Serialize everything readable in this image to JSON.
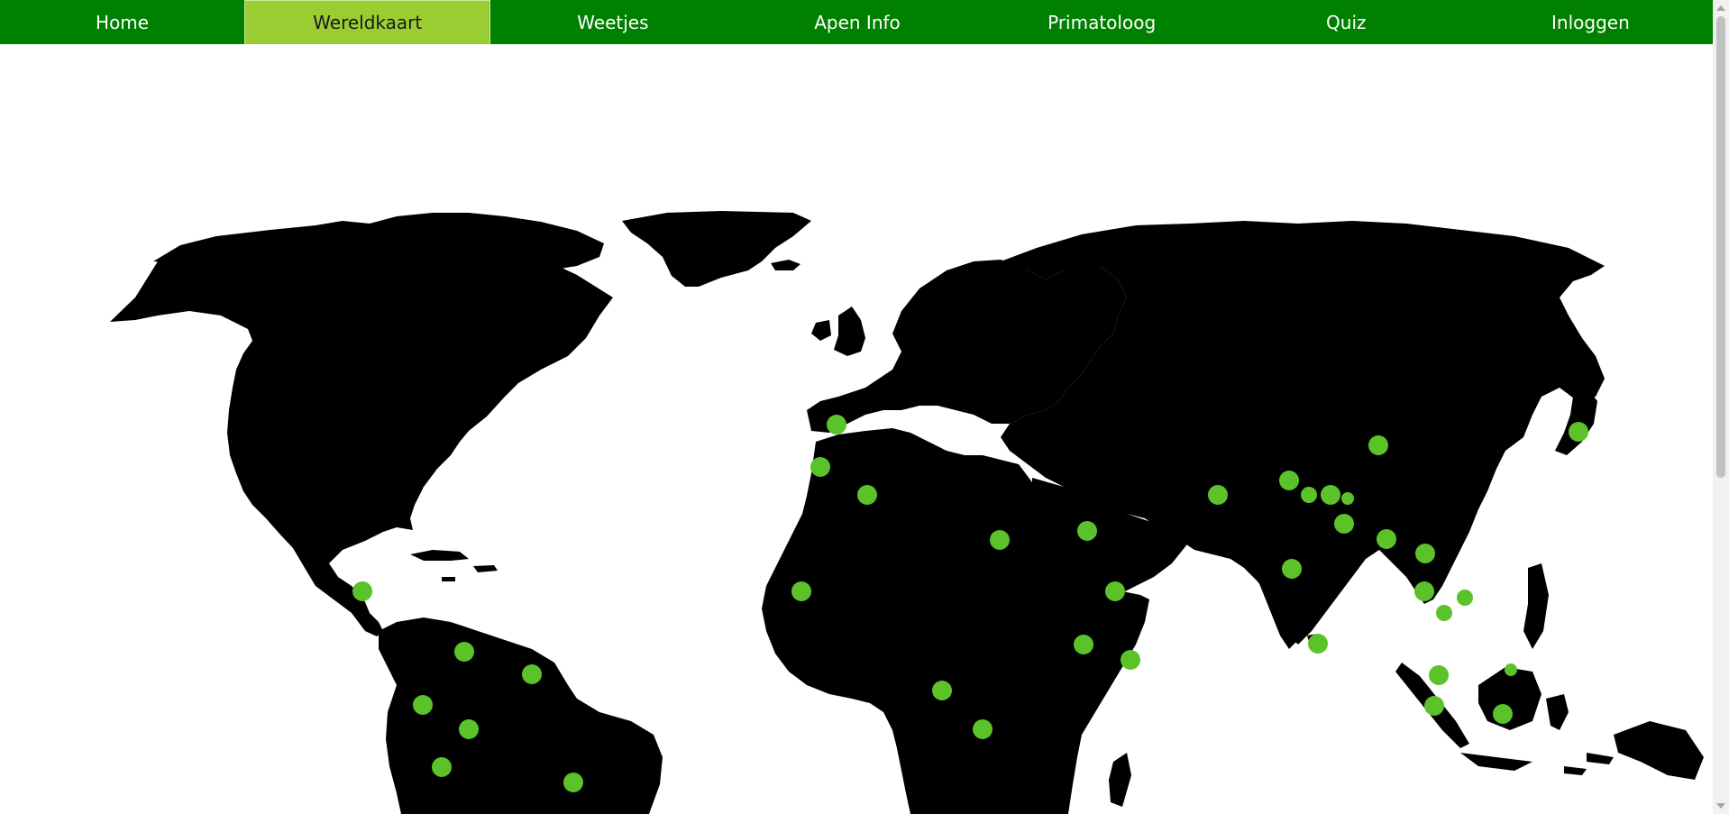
{
  "nav": {
    "items": [
      {
        "label": "Home"
      },
      {
        "label": "Wereldkaart"
      },
      {
        "label": "Weetjes"
      },
      {
        "label": "Apen Info"
      },
      {
        "label": "Primatoloog"
      },
      {
        "label": "Quiz"
      },
      {
        "label": "Inloggen"
      }
    ],
    "active_index": 1
  },
  "colors": {
    "nav_bg": "#008000",
    "nav_active": "#9acd32",
    "land": "#000000",
    "marker": "#5cc229"
  },
  "map": {
    "marker_count": 44
  }
}
